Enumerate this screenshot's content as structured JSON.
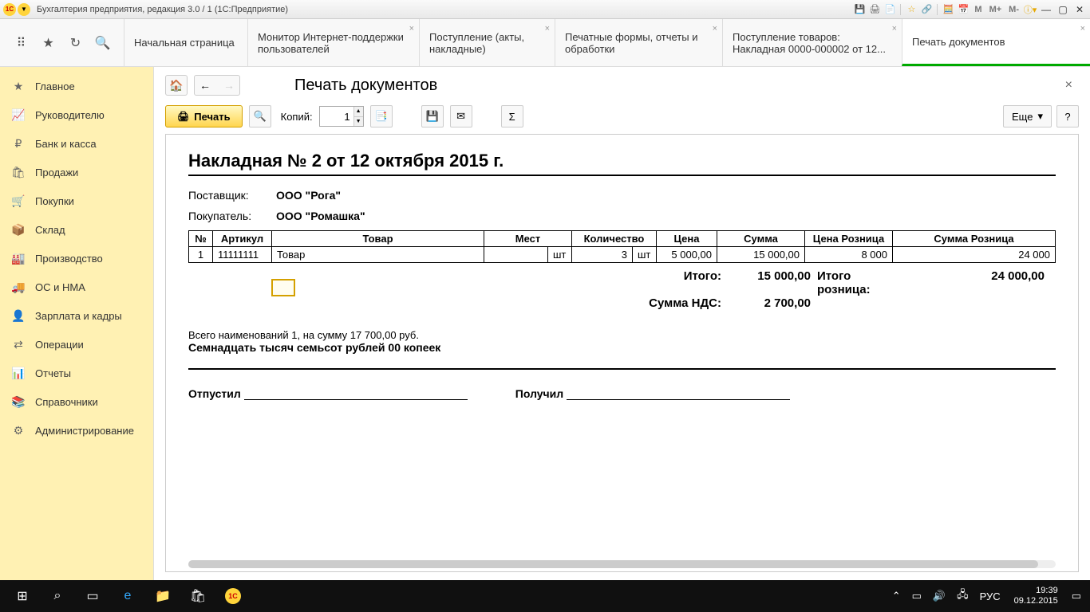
{
  "titlebar": {
    "title": "Бухгалтерия предприятия, редакция 3.0 / 1  (1С:Предприятие)",
    "m_buttons": [
      "M",
      "M+",
      "M-"
    ]
  },
  "tabs": [
    {
      "label": "Начальная страница",
      "closable": false
    },
    {
      "label": "Монитор Интернет-поддержки пользователей",
      "closable": true
    },
    {
      "label": "Поступление (акты, накладные)",
      "closable": true
    },
    {
      "label": "Печатные формы, отчеты и обработки",
      "closable": true
    },
    {
      "label": "Поступление товаров: Накладная 0000-000002 от 12...",
      "closable": true
    },
    {
      "label": "Печать документов",
      "closable": true,
      "active": true
    }
  ],
  "sidebar": [
    {
      "icon": "★",
      "label": "Главное"
    },
    {
      "icon": "📈",
      "label": "Руководителю"
    },
    {
      "icon": "₽",
      "label": "Банк и касса"
    },
    {
      "icon": "🛍",
      "label": "Продажи"
    },
    {
      "icon": "🛒",
      "label": "Покупки"
    },
    {
      "icon": "📦",
      "label": "Склад"
    },
    {
      "icon": "🏭",
      "label": "Производство"
    },
    {
      "icon": "🚚",
      "label": "ОС и НМА"
    },
    {
      "icon": "👤",
      "label": "Зарплата и кадры"
    },
    {
      "icon": "⇄",
      "label": "Операции"
    },
    {
      "icon": "📊",
      "label": "Отчеты"
    },
    {
      "icon": "📚",
      "label": "Справочники"
    },
    {
      "icon": "⚙",
      "label": "Администрирование"
    }
  ],
  "content": {
    "page_title": "Печать документов",
    "print_label": "Печать",
    "copies_label": "Копий:",
    "copies_value": "1",
    "more_label": "Еще",
    "help_label": "?"
  },
  "document": {
    "title": "Накладная № 2 от 12 октября 2015 г.",
    "supplier_label": "Поставщик:",
    "supplier_value": "ООО \"Рога\"",
    "buyer_label": "Покупатель:",
    "buyer_value": "ООО \"Ромашка\"",
    "headers": [
      "№",
      "Артикул",
      "Товар",
      "Мест",
      "Количество",
      "Цена",
      "Сумма",
      "Цена Розница",
      "Сумма Розница"
    ],
    "rows": [
      {
        "num": "1",
        "art": "11111111",
        "name": "Товар",
        "place_unit": "шт",
        "qty": "3",
        "qty_unit": "шт",
        "price": "5 000,00",
        "sum": "15 000,00",
        "price_r": "8 000",
        "sum_r": "24 000"
      }
    ],
    "totals": {
      "itogo_label": "Итого:",
      "itogo_value": "15 000,00",
      "itogo_r_label": "Итого розница:",
      "itogo_r_value": "24 000,00",
      "nds_label": "Сумма НДС:",
      "nds_value": "2 700,00"
    },
    "summary_count": "Всего наименований 1, на сумму 17 700,00 руб.",
    "summary_words": "Семнадцать тысяч семьсот рублей 00 копеек",
    "sig_out": "Отпустил",
    "sig_in": "Получил"
  },
  "taskbar": {
    "lang": "РУС",
    "time": "19:39",
    "date": "09.12.2015"
  }
}
